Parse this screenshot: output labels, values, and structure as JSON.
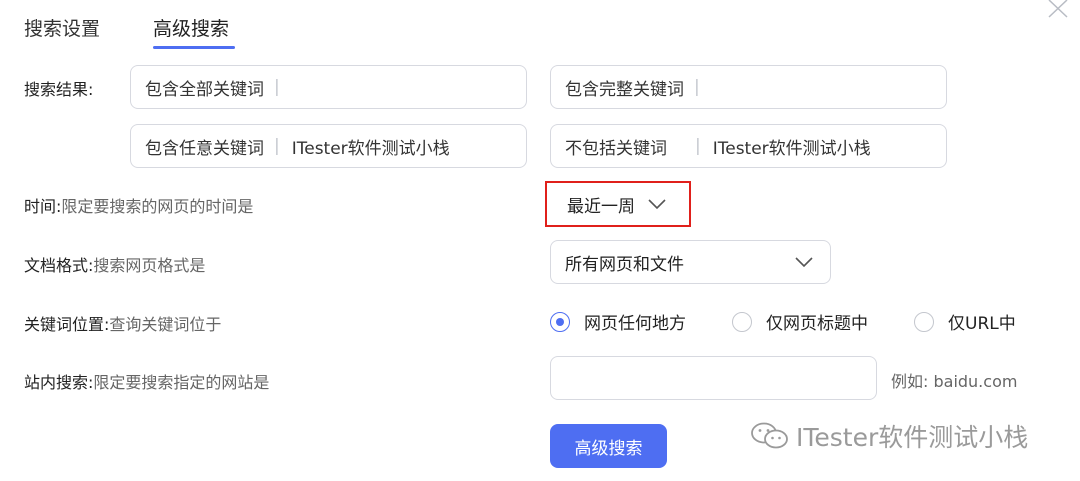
{
  "tabs": {
    "settings": "搜索设置",
    "advanced": "高级搜索"
  },
  "search_results": {
    "label": "搜索结果:",
    "all_keywords": {
      "label": "包含全部关键词",
      "value": ""
    },
    "exact_phrase": {
      "label": "包含完整关键词",
      "value": ""
    },
    "any_keywords": {
      "label": "包含任意关键词",
      "value": "ITester软件测试小栈"
    },
    "exclude_keywords": {
      "label": "不包括关键词",
      "value": "ITester软件测试小栈"
    }
  },
  "time": {
    "label": "时间:",
    "desc": "限定要搜索的网页的时间是",
    "selected": "最近一周"
  },
  "format": {
    "label": "文档格式:",
    "desc": "搜索网页格式是",
    "selected": "所有网页和文件"
  },
  "keyword_position": {
    "label": "关键词位置:",
    "desc": "查询关键词位于",
    "options": [
      "网页任何地方",
      "仅网页标题中",
      "仅URL中"
    ],
    "selected": "网页任何地方"
  },
  "site_search": {
    "label": "站内搜索:",
    "desc": "限定要搜索指定的网站是",
    "value": "",
    "example": "例如: baidu.com"
  },
  "submit_label": "高级搜索",
  "watermark": "ITester软件测试小栈",
  "colors": {
    "accent": "#4e6ef2",
    "highlight_border": "#e0201b"
  }
}
